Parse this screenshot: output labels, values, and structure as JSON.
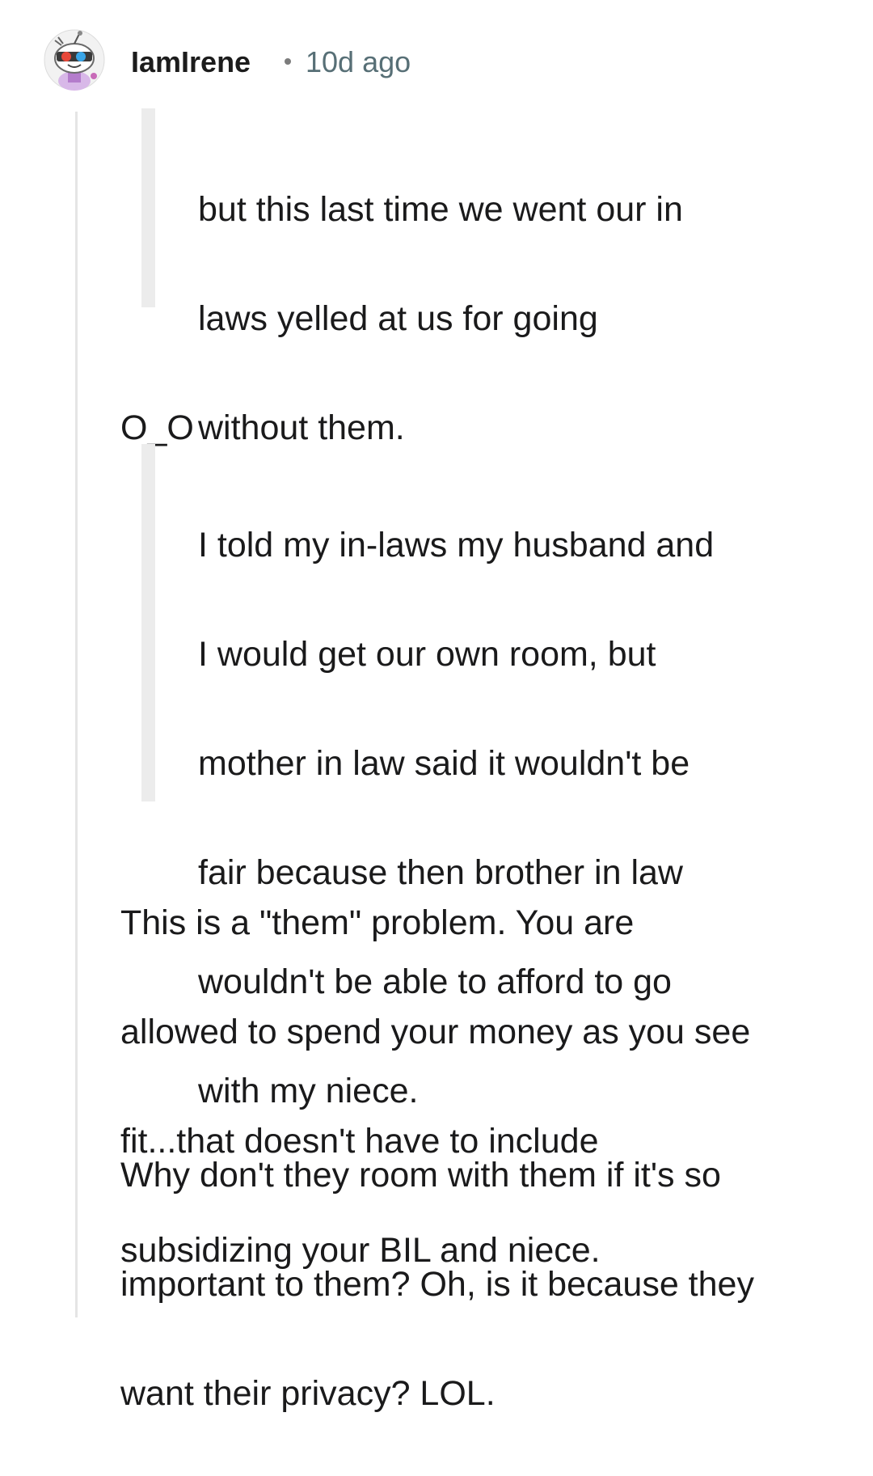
{
  "comment": {
    "author": "IamIrene",
    "separator_icon": "dot-separator",
    "time_ago": "10d ago",
    "avatar_icon": "snoo-avatar-icon",
    "thread_line_color": "#e5e5e5",
    "quote_bar_color": "#ececec",
    "blocks": [
      {
        "type": "quote",
        "lines": [
          "but this last time we went our in",
          "laws yelled at us for going",
          "without them."
        ]
      },
      {
        "type": "paragraph",
        "lines": [
          "O_O"
        ]
      },
      {
        "type": "quote",
        "lines": [
          "I told my in-laws my husband and",
          "I would get our own room, but",
          "mother in law said it wouldn't be",
          "fair because then brother in law",
          "wouldn't be able to afford to go",
          "with my niece."
        ]
      },
      {
        "type": "paragraph",
        "lines": [
          "This is a \"them\" problem. You are",
          "allowed to spend your money as you see",
          "fit...that doesn't have to include",
          "subsidizing your BIL and niece."
        ]
      },
      {
        "type": "paragraph",
        "lines": [
          "Why don't they room with them if it's so",
          "important to them? Oh, is it because they",
          "want their privacy? LOL."
        ]
      }
    ]
  }
}
